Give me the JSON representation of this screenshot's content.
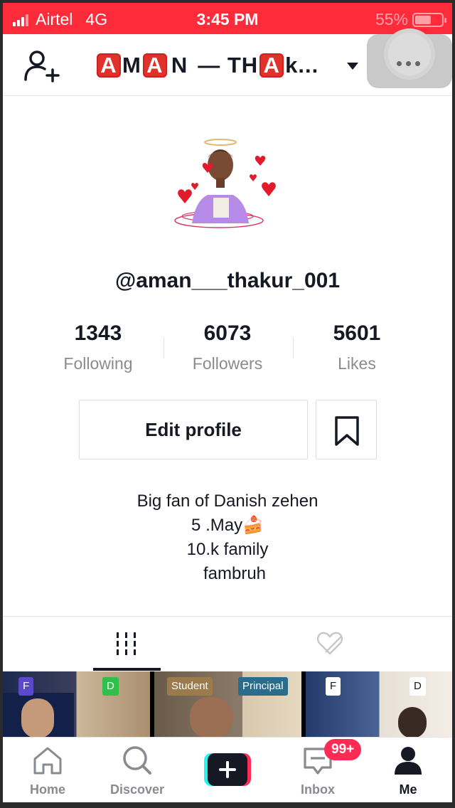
{
  "status_bar": {
    "carrier": "Airtel",
    "network": "4G",
    "time": "3:45 PM",
    "battery": "55%"
  },
  "header": {
    "title_parts": [
      "A",
      "M",
      "A",
      "N",
      " — TH",
      "A",
      "k..."
    ],
    "more_icon": "ellipsis-icon",
    "add_icon": "add-user-icon"
  },
  "profile": {
    "handle": "@aman___thakur_001",
    "stats": [
      {
        "value": "1343",
        "label": "Following"
      },
      {
        "value": "6073",
        "label": "Followers"
      },
      {
        "value": "5601",
        "label": "Likes"
      }
    ],
    "edit_label": "Edit profile",
    "bio": [
      "Big fan of Danish zehen",
      "5 .May🍰",
      "10.k family",
      "   fambruh"
    ]
  },
  "tabs": [
    {
      "icon": "grid-icon",
      "active": true
    },
    {
      "icon": "liked-hidden-icon",
      "active": false
    }
  ],
  "videos": [
    {
      "labels": [
        "F",
        "D"
      ],
      "label_colors": [
        "#5a49c9",
        "#2fbf4a"
      ]
    },
    {
      "labels": [
        "Student",
        "Principal"
      ],
      "label_colors": [
        "#9b7a4b",
        "#2a6c8c"
      ]
    },
    {
      "labels": [
        "F",
        "D"
      ],
      "label_colors": [
        "#ffffff",
        "#ffffff"
      ]
    }
  ],
  "bottom_nav": {
    "home": "Home",
    "discover": "Discover",
    "inbox": "Inbox",
    "me": "Me",
    "inbox_badge": "99+"
  },
  "colors": {
    "accent": "#fe2c55",
    "status_bar": "#fe2c3b"
  }
}
